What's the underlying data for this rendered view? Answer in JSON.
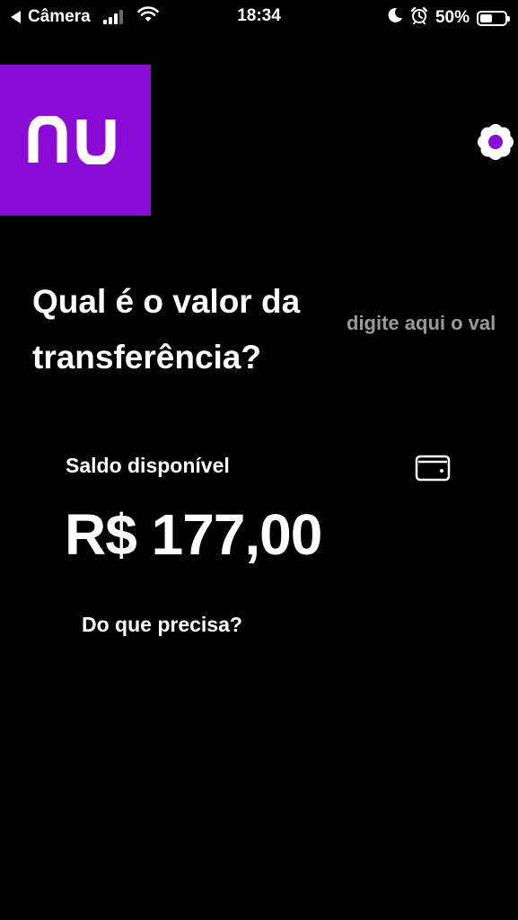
{
  "status_bar": {
    "back_label": "Câmera",
    "time": "18:34",
    "battery_percent": "50%",
    "battery_level": 0.5,
    "icons": [
      "back-arrow-icon",
      "cellular-signal-icon",
      "wifi-icon",
      "moon-icon",
      "alarm-icon",
      "battery-icon"
    ]
  },
  "header": {
    "logo_text": "nu",
    "logo_color": "#8a0ad6",
    "settings_icon": "gear-icon"
  },
  "transfer": {
    "question": "Qual é o valor da transferência?",
    "amount_placeholder": "digite aqui o val"
  },
  "balance": {
    "label": "Saldo disponível",
    "value": "R$ 177,00",
    "wallet_icon": "wallet-icon"
  },
  "help": {
    "label": "Do que precisa?"
  }
}
